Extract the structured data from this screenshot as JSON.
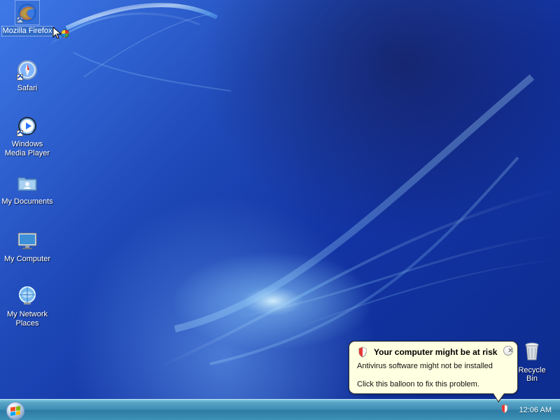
{
  "desktop": {
    "icons": [
      {
        "label": "Mozilla Firefox",
        "selected": true
      },
      {
        "label": "Safari",
        "selected": false
      },
      {
        "label": "Windows Media Player",
        "selected": false
      },
      {
        "label": "My Documents",
        "selected": false
      },
      {
        "label": "My Computer",
        "selected": false
      },
      {
        "label": "My Network Places",
        "selected": false
      },
      {
        "label": "Recycle Bin",
        "selected": false
      }
    ]
  },
  "balloon": {
    "title": "Your computer might be at risk",
    "body_line_1": "Antivirus software might not be installed",
    "body_line_2": "Click this balloon to fix this problem.",
    "close_symbol": "×"
  },
  "taskbar": {
    "clock": "12:06 AM"
  },
  "colors": {
    "selection": "#316ac5",
    "balloon_background": "#ffffe1",
    "taskbar_accent": "#3b8db4"
  },
  "icons": {
    "start": "windows-logo-icon",
    "firefox": "firefox-icon",
    "safari": "safari-icon",
    "media_player": "windows-media-player-icon",
    "documents": "folder-icon",
    "computer": "computer-icon",
    "network": "network-globe-icon",
    "recycle_bin": "recycle-bin-icon",
    "security": "security-shield-icon"
  }
}
